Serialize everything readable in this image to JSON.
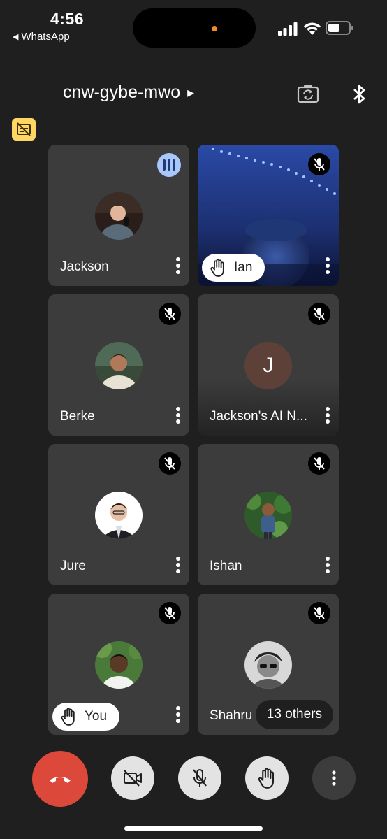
{
  "status_bar": {
    "time": "4:56",
    "back_app": "WhatsApp",
    "back_icon": "◀"
  },
  "header": {
    "meeting_code": "cnw-gybe-mwo",
    "chevron": "▸"
  },
  "colors": {
    "background": "#1f1f1f",
    "tile": "#3c3c3c",
    "end_call": "#dc483a",
    "speaking": "#a8c7fa",
    "caption_badge": "#fdd663"
  },
  "participants": [
    {
      "name": "Jackson",
      "status": "speaking"
    },
    {
      "name": "Ian",
      "status": "muted",
      "hand_raised": true,
      "video": true
    },
    {
      "name": "Berke",
      "status": "muted"
    },
    {
      "name": "Jackson's AI N...",
      "status": "muted",
      "initial": "J"
    },
    {
      "name": "Jure",
      "status": "muted"
    },
    {
      "name": "Ishan",
      "status": "muted"
    },
    {
      "name": "You",
      "status": "muted",
      "hand_raised": true
    },
    {
      "name": "Shahru",
      "status": "muted"
    }
  ],
  "others": "13 others"
}
